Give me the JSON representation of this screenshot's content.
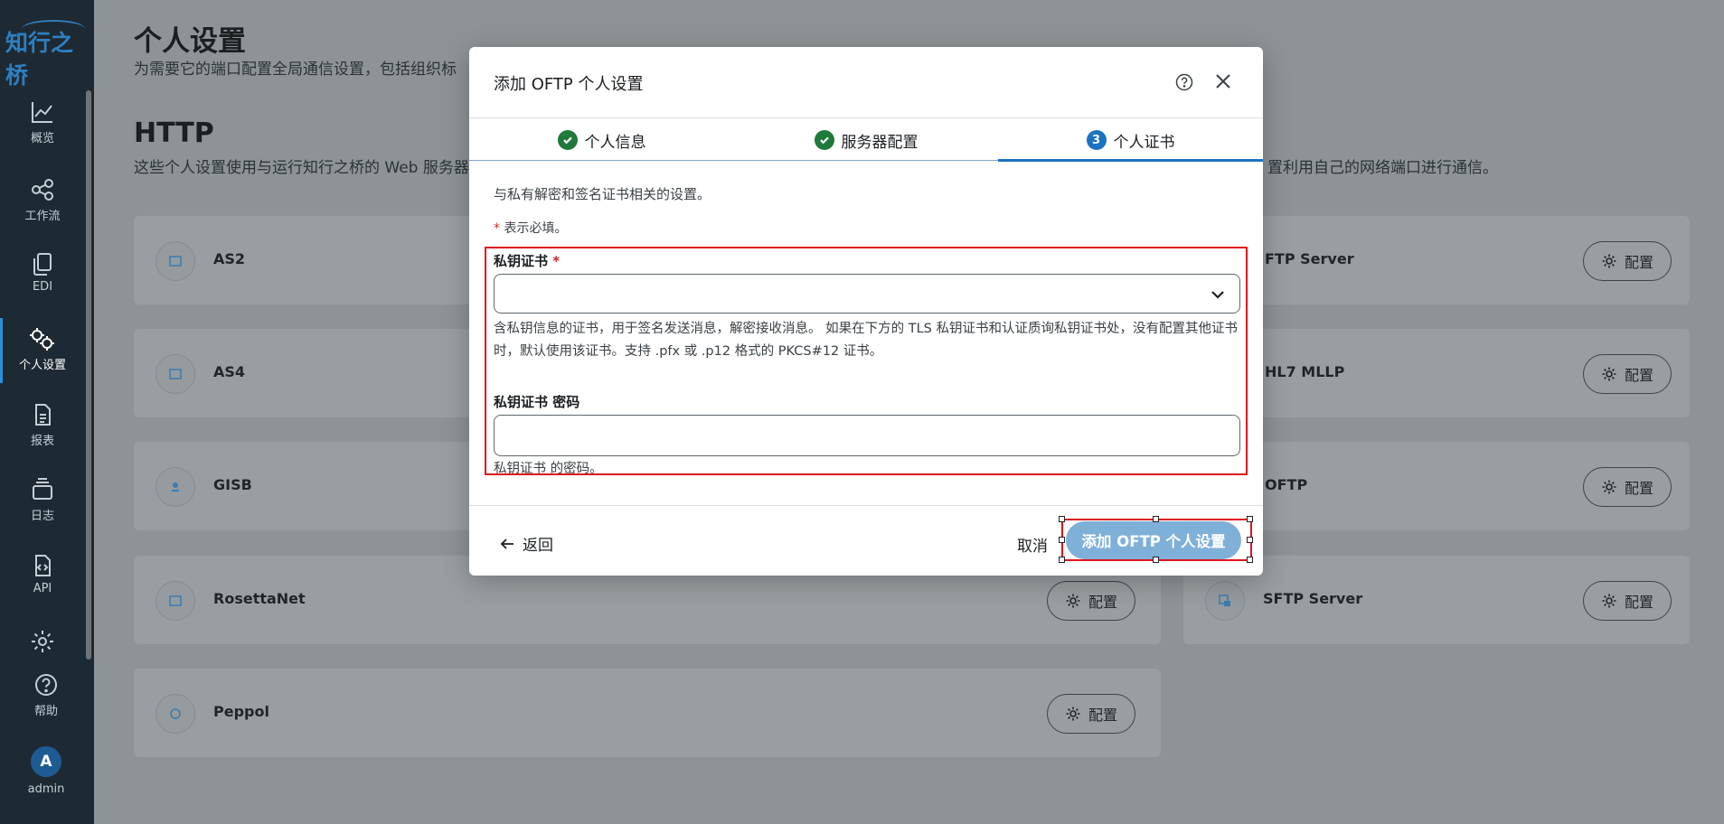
{
  "sidebar": {
    "logo": "知行之桥",
    "items": [
      {
        "label": "概览",
        "icon": "chart-line-icon"
      },
      {
        "label": "工作流",
        "icon": "share-nodes-icon"
      },
      {
        "label": "EDI",
        "icon": "copy-files-icon"
      },
      {
        "label": "个人设置",
        "icon": "gears-icon"
      },
      {
        "label": "报表",
        "icon": "document-icon"
      },
      {
        "label": "日志",
        "icon": "layers-icon"
      },
      {
        "label": "API",
        "icon": "code-file-icon"
      },
      {
        "label": "",
        "icon": "gear-icon"
      },
      {
        "label": "帮助",
        "icon": "help-circle-icon"
      }
    ],
    "user": {
      "initial": "A",
      "name": "admin"
    }
  },
  "page": {
    "title": "个人设置",
    "subtitle": "为需要它的端口配置全局通信设置，包括组织标",
    "section_title": "HTTP",
    "section_desc_left": "这些个人设置使用与运行知行之桥的 Web 服务器",
    "section_desc_right": "置利用自己的网络端口进行通信。"
  },
  "cards_left": [
    {
      "name": "AS2"
    },
    {
      "name": "AS4"
    },
    {
      "name": "GISB"
    },
    {
      "name": "RosettaNet",
      "button": "配置"
    },
    {
      "name": "Peppol",
      "button": "配置"
    }
  ],
  "cards_right": [
    {
      "name": "FTP Server",
      "button": "配置"
    },
    {
      "name": "HL7 MLLP",
      "button": "配置"
    },
    {
      "name": "OFTP",
      "button": "配置"
    },
    {
      "name": "SFTP Server",
      "button": "配置"
    }
  ],
  "modal": {
    "title": "添加 OFTP 个人设置",
    "steps": [
      {
        "label": "个人信息",
        "state": "done"
      },
      {
        "label": "服务器配置",
        "state": "done"
      },
      {
        "label": "个人证书",
        "state": "active",
        "number": "3"
      }
    ],
    "intro": "与私有解密和签名证书相关的设置。",
    "required_star": "*",
    "required_note": "表示必填。",
    "fields": {
      "private_cert": {
        "label": "私钥证书",
        "value": "",
        "help": "含私钥信息的证书，用于签名发送消息，解密接收消息。 如果在下方的 TLS 私钥证书和认证质询私钥证书处，没有配置其他证书时，默认使用该证书。支持 .pfx 或 .p12 格式的 PKCS#12 证书。"
      },
      "cert_password": {
        "label": "私钥证书 密码",
        "value": "",
        "help": "私钥证书 的密码。"
      }
    },
    "footer": {
      "back": "返回",
      "cancel": "取消",
      "submit": "添加 OFTP 个人设置"
    }
  },
  "colors": {
    "overlay": "#8d9396",
    "sidebar": "#1e2a33",
    "accent": "#1b72c0",
    "success": "#1f7a3a",
    "highlight": "#e0141c",
    "primary_disabled": "#7fb0d8"
  }
}
